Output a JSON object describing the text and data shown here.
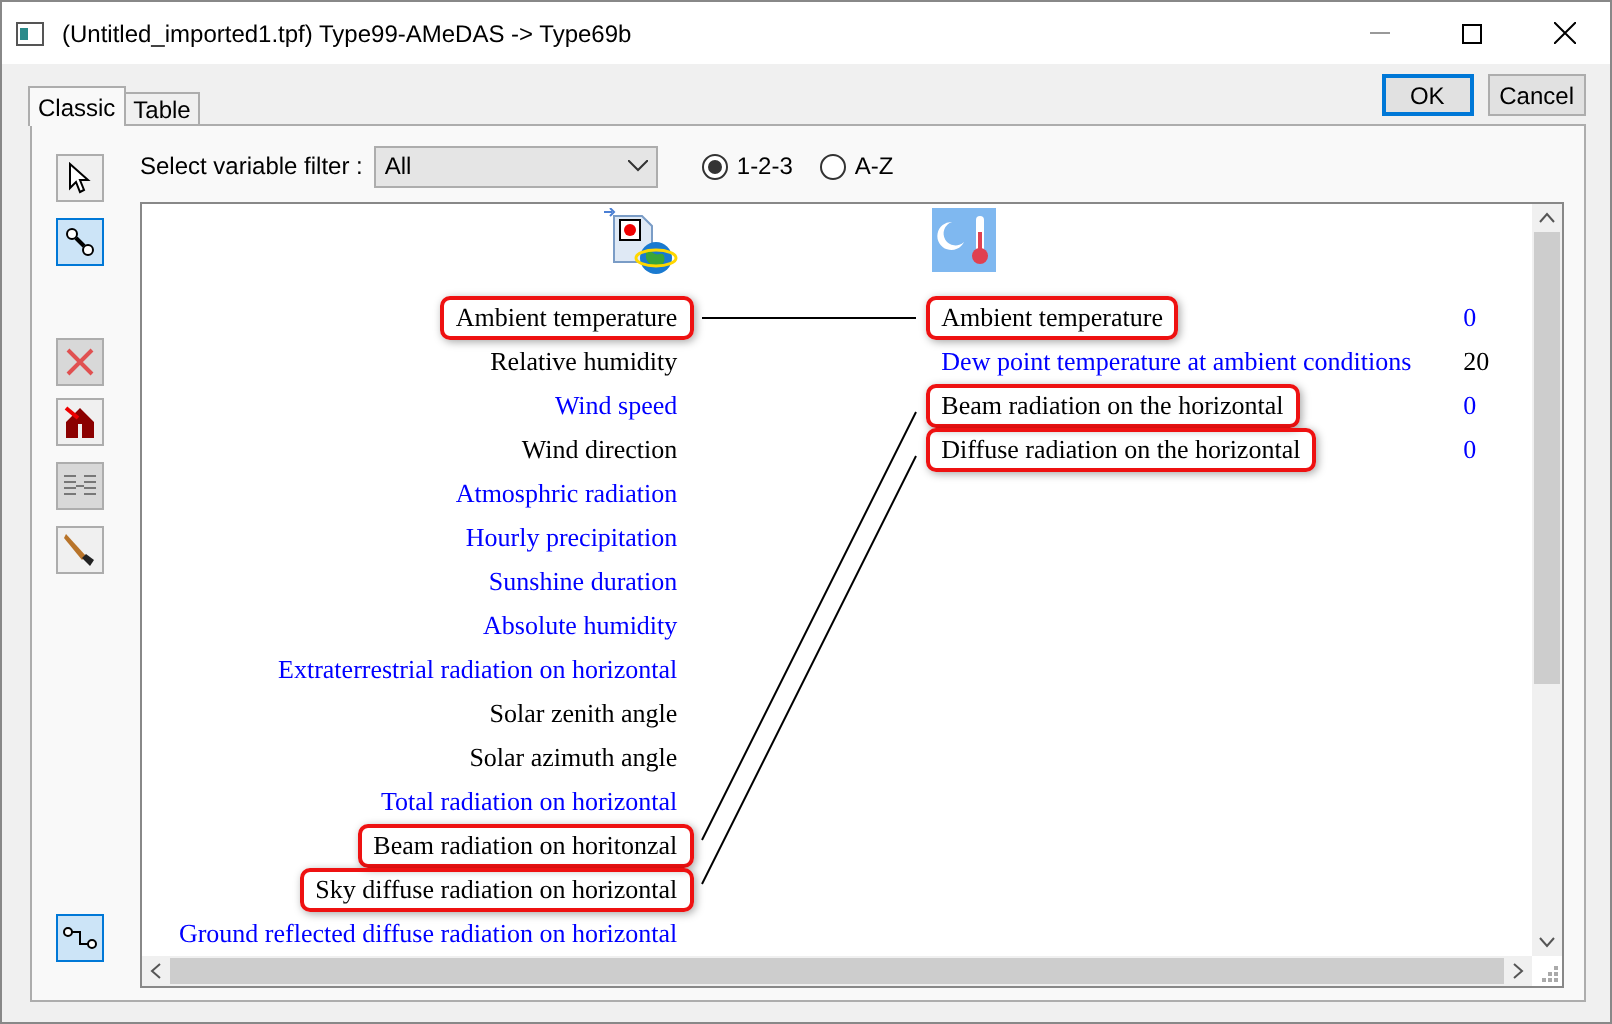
{
  "window": {
    "title": "(Untitled_imported1.tpf) Type99-AMeDAS -> Type69b"
  },
  "tabs": [
    {
      "label": "Classic",
      "selected": true
    },
    {
      "label": "Table",
      "selected": false
    }
  ],
  "buttons": [
    {
      "label": "OK",
      "default": true
    },
    {
      "label": "Cancel",
      "default": false
    }
  ],
  "tools": [
    {
      "kind": "pointer",
      "selected": false,
      "disabled": false
    },
    {
      "kind": "link",
      "selected": true,
      "disabled": false
    },
    {
      "kind": "delete",
      "selected": false,
      "disabled": true
    },
    {
      "kind": "remove",
      "selected": false,
      "disabled": false
    },
    {
      "kind": "lines",
      "selected": false,
      "disabled": true
    },
    {
      "kind": "brush",
      "selected": false,
      "disabled": false
    },
    {
      "kind": "autolink",
      "selected": true,
      "disabled": false
    }
  ],
  "filter": {
    "label": "Select variable filter :",
    "value": "All"
  },
  "sort_options": [
    {
      "label": "1-2-3",
      "selected": true
    },
    {
      "label": "A-Z",
      "selected": false
    }
  ],
  "outputs": [
    {
      "label": "Ambient temperature",
      "color": "#000000",
      "linked": true
    },
    {
      "label": "Relative humidity",
      "color": "#000000",
      "linked": false
    },
    {
      "label": "Wind speed",
      "color": "#0000ff",
      "linked": false
    },
    {
      "label": "Wind direction",
      "color": "#000000",
      "linked": false
    },
    {
      "label": "Atmosphric radiation",
      "color": "#0000ff",
      "linked": false
    },
    {
      "label": "Hourly precipitation",
      "color": "#0000ff",
      "linked": false
    },
    {
      "label": "Sunshine duration",
      "color": "#0000ff",
      "linked": false
    },
    {
      "label": "Absolute humidity",
      "color": "#0000ff",
      "linked": false
    },
    {
      "label": "Extraterrestrial radiation on horizontal",
      "color": "#0000ff",
      "linked": false
    },
    {
      "label": "Solar zenith angle",
      "color": "#000000",
      "linked": false
    },
    {
      "label": "Solar azimuth angle",
      "color": "#000000",
      "linked": false
    },
    {
      "label": "Total radiation on horizontal",
      "color": "#0000ff",
      "linked": false
    },
    {
      "label": "Beam radiation on horitonzal",
      "color": "#000000",
      "linked": true
    },
    {
      "label": "Sky diffuse radiation on horizontal",
      "color": "#000000",
      "linked": true
    },
    {
      "label": "Ground reflected diffuse radiation on horizontal",
      "color": "#0000ff",
      "linked": false
    }
  ],
  "inputs": [
    {
      "label": "Ambient temperature",
      "color": "#000000",
      "linked": true,
      "value": {
        "text": "0",
        "color": "#0000ff"
      }
    },
    {
      "label": "Dew point temperature at ambient conditions",
      "color": "#0000ff",
      "linked": false,
      "value": {
        "text": "20",
        "color": "#000000"
      }
    },
    {
      "label": "Beam radiation on the horizontal",
      "color": "#000000",
      "linked": true,
      "value": {
        "text": "0",
        "color": "#0000ff"
      }
    },
    {
      "label": "Diffuse radiation on the horizontal",
      "color": "#000000",
      "linked": true,
      "value": {
        "text": "0",
        "color": "#0000ff"
      }
    }
  ]
}
